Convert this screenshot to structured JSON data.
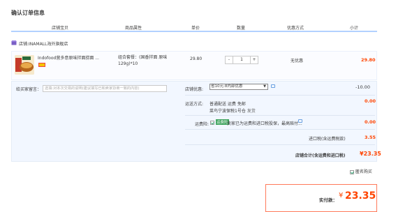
{
  "page_title": "确认订单信息",
  "columns": [
    "店铺宝贝",
    "商品属性",
    "单价",
    "数量",
    "优惠方式",
    "小计"
  ],
  "shop": {
    "label": "店铺:",
    "name": "INAMALL海外旗舰店"
  },
  "item": {
    "name": "Indofood营多意原味拌面捞面 ...",
    "attr": "组合套餐：(国香拌面 原味129g)*10",
    "price": "29.80",
    "qty": "1",
    "minus": "-",
    "plus": "+",
    "discount": "无优惠",
    "subtotal": "29.80"
  },
  "message": {
    "label": "给买家留言：",
    "placeholder": "选填:对本次交易的说明(建议填写已和卖家协商一致的内容)"
  },
  "shop_coupon": {
    "label": "店铺优惠:",
    "selected": "省10元:8内部优惠",
    "value": "-10.00"
  },
  "shipping": {
    "label": "运送方式:",
    "line1": "普通配送 运费 免邮",
    "line2": "菜鸟宁波保税1号仓",
    "line2b": "发货",
    "value": "0.00"
  },
  "insurance": {
    "label": "运费险:",
    "badge": "运费险",
    "text": "卖家已为运费和进口税投保，最高赔付...",
    "value": "0.00"
  },
  "import_tax": {
    "label": "进口税(含运费税款)",
    "value": "3.55"
  },
  "shop_total": {
    "label": "店铺合计(含运费和进口税)",
    "value": "¥23.35"
  },
  "anonymous": {
    "label": "匿名购买"
  },
  "pay": {
    "label": "实付款：",
    "currency": "¥",
    "value": "23.35"
  }
}
